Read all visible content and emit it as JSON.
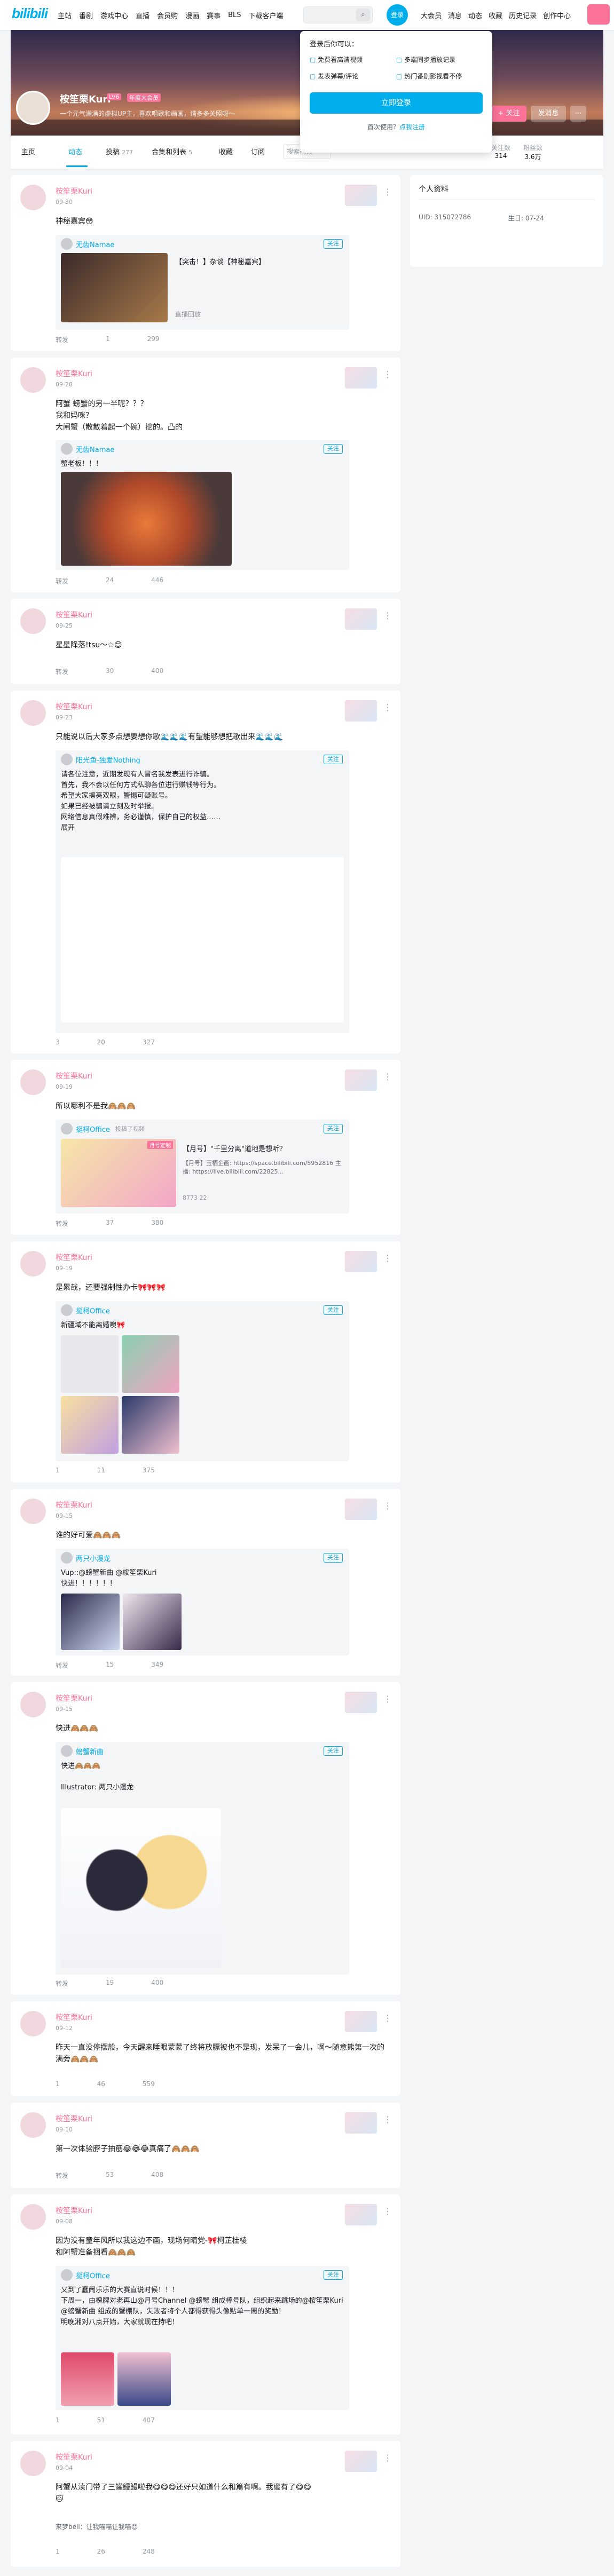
{
  "topbar": {
    "logo": "bilibili",
    "nav": [
      "主站",
      "番剧",
      "游戏中心",
      "直播",
      "会员购",
      "漫画",
      "赛事",
      "BLS",
      "下载客户端"
    ],
    "login": "登录",
    "right": [
      "大会员",
      "消息",
      "动态",
      "收藏",
      "历史记录",
      "创作中心"
    ],
    "accent": "#00aeec",
    "pink": "#fb7299"
  },
  "popup": {
    "title": "登录后你可以：",
    "perks": [
      "免费看高清视频",
      "多端同步播放记录",
      "发表弹幕/评论",
      "热门番剧影视看不停"
    ],
    "login": "立即登录",
    "reg_text": "首次使用？",
    "reg_link": "点我注册"
  },
  "profile": {
    "name": "桉笙栗Kuri",
    "lv": "LV6",
    "vip": "年度大会员",
    "sign": "一个元气满满的虚拟UP主，喜欢唱歌和画画，请多多关照呀～",
    "follow": "+ 关注",
    "message": "发消息",
    "more": "⋯",
    "stats": [
      {
        "label": "关注数",
        "value": "314"
      },
      {
        "label": "粉丝数",
        "value": "3.6万"
      }
    ]
  },
  "tabs": {
    "items": [
      "主页",
      "动态",
      "投稿",
      "合集和列表",
      "收藏",
      "订阅"
    ],
    "counts": [
      "",
      "",
      "277",
      "5",
      "",
      ""
    ],
    "search": "搜索视频"
  },
  "sidebar": {
    "title": "个人资料",
    "uid": "UID: 315072786",
    "birthday": "生日: 07-24"
  },
  "posts": [
    {
      "name": "桉笙栗Kuri",
      "time": "09-30",
      "text": "神秘嘉宾😳",
      "fwd_name": "无齿Namae",
      "fwd_video": "【突击！】杂谈【神秘嘉宾】",
      "fwd_meta": "直播回放",
      "stats": [
        "转发",
        "1",
        "299"
      ]
    },
    {
      "name": "桉笙栗Kuri",
      "time": "09-28",
      "text": "阿蟹 螃蟹的另一半呢？？？\n我和妈咪？\n大闸蟹（散散着起一个碗）挖的。凸的",
      "fwd_name": "无齿Namae",
      "fwd_text": "蟹老板！！！",
      "stats": [
        "转发",
        "24",
        "446"
      ]
    },
    {
      "name": "桉笙栗Kuri",
      "time": "09-25",
      "text": "星星降落!tsu～☆😊",
      "stats": [
        "转发",
        "30",
        "400"
      ]
    },
    {
      "name": "桉笙栗Kuri",
      "time": "09-23",
      "text": "只能说以后大家多点想要想你歌🌊🌊🌊有望能够想把歌出来🌊🌊🌊",
      "fwd_name": "阳光鱼-独爱Nothing",
      "fwd_text": "请各位注意，近期发现有人冒名我发表进行诈骗。\n首先，我不会以任何方式私聊各位进行赚钱等行为。\n希望大家擦亮双眼，警惕可疑账号。\n如果已经被骗请立刻及时举报。\n网络信息真假难辨，务必谨慎，保护自己的权益……\n展开",
      "stats": [
        "3",
        "20",
        "327"
      ]
    },
    {
      "name": "桉笙栗Kuri",
      "time": "09-19",
      "text": "所以哪利不是我🙈🙈🙈",
      "fwd_name": "挺柯Office",
      "fwd_sub": "投稿了视频",
      "fwd_video": "【月号】\"千里分离\"道地是想听？",
      "fwd_desc": "【月号】玉栖企画: https://space.bilibili.com/5952816 主播: https://live.bilibili.com/22825...",
      "fwd_tag": "月号定制",
      "fwd_meta": "8773  22",
      "stats": [
        "转发",
        "37",
        "380"
      ]
    },
    {
      "name": "桉笙栗Kuri",
      "time": "09-19",
      "text": "是累哉，还要强制性办卡🎀🎀🎀",
      "fwd_name": "挺柯Office",
      "fwd_text": "新疆域不能离婚噢🎀",
      "stats": [
        "1",
        "11",
        "375"
      ]
    },
    {
      "name": "桉笙栗Kuri",
      "time": "09-15",
      "text": "谁的好可爱🙈🙈🙈",
      "fwd_name": "两只小漫龙",
      "fwd_text": "Vup::@螃蟹新曲 @桉笙栗Kuri\n快进！！！！！！",
      "stats": [
        "转发",
        "15",
        "349"
      ]
    },
    {
      "name": "桉笙栗Kuri",
      "time": "09-15",
      "text": "快进🙈🙈🙈",
      "fwd_name": "螃蟹新曲",
      "fwd_text": "快进🙈🙈🙈\n\nIllustrator: 两只小漫龙",
      "stats": [
        "转发",
        "19",
        "400"
      ]
    },
    {
      "name": "桉笙栗Kuri",
      "time": "09-12",
      "text": "昨天一直没停摆般，今天醒来睡眼蒙蒙了终将放膘被也不是现，发呆了一会儿，啊～随意熊第一次的满旁🙈🙈🙈",
      "stats": [
        "1",
        "46",
        "559"
      ]
    },
    {
      "name": "桉笙栗Kuri",
      "time": "09-10",
      "text": "第一次体验脖子抽筋😂😂😂真痛了🙈🙈🙈",
      "stats": [
        "转发",
        "53",
        "408"
      ]
    },
    {
      "name": "桉笙栗Kuri",
      "time": "09-08",
      "text": "因为没有童年风所以我这边不画，现场何晴党-🎀柯芷桂棱\n和阿蟹准备捆看🙈🙈🙈",
      "fwd_name": "挺柯Office",
      "fwd_text": "又到了蠢闹乐乐的大赛直说时候！！！\n下周一，由槐牌对老再山@月号Channel @螃蟹 组成棒号队，组织起来跳场的@桉笙栗Kuri @螃蟹新曲 组成的蟹棚队，失败者将个人都得获得头像贴单一周的奖励！\n明晚湘对八点开始，大家就现在持吧！",
      "stats": [
        "1",
        "51",
        "407"
      ]
    },
    {
      "name": "桉笙栗Kuri",
      "time": "09-04",
      "text": "阿蟹从渎门带了三罐鳗鳗啦我😋😋😋还好只如道什么和篇有啊。我蜜有了😋😋\n🐱",
      "sub": "来梦bell：让我喵喵让我喵😊",
      "stats": [
        "1",
        "26",
        "248"
      ]
    }
  ]
}
